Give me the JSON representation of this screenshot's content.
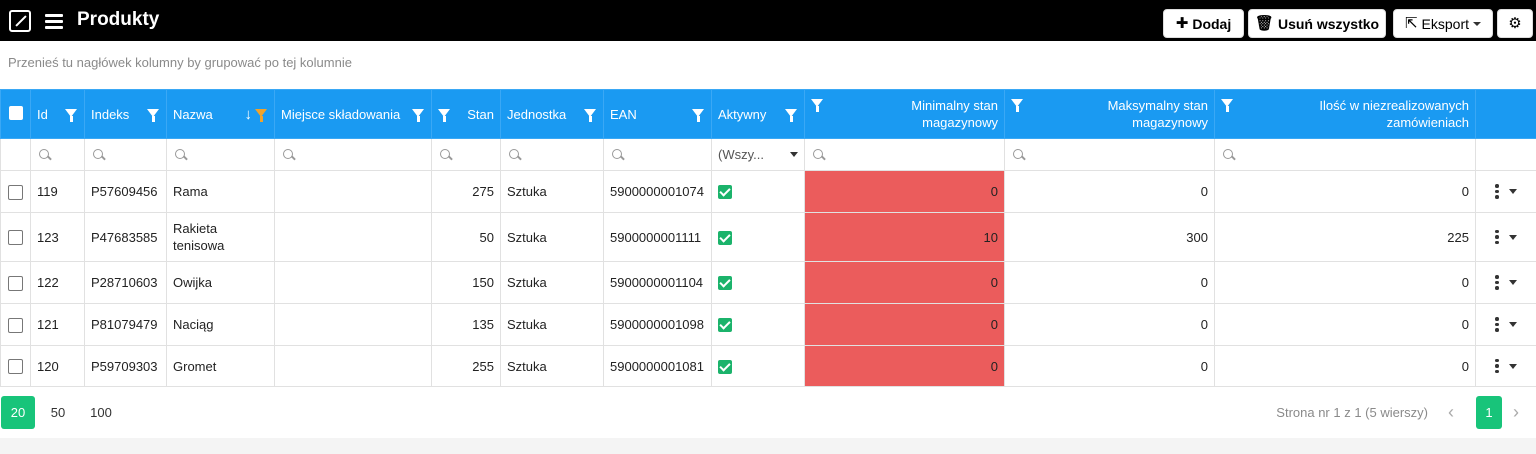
{
  "header": {
    "title": "Produkty",
    "buttons": {
      "add": "Dodaj",
      "delete_all": "Usuń wszystko",
      "export": "Eksport"
    }
  },
  "group_hint": "Przenieś tu nagłówek kolumny by grupować po tej kolumnie",
  "columns": {
    "id": "Id",
    "index": "Indeks",
    "name": "Nazwa",
    "location": "Miejsce składowania",
    "stock": "Stan",
    "unit": "Jednostka",
    "ean": "EAN",
    "active": "Aktywny",
    "min_stock_1": "Minimalny stan",
    "min_stock_2": "magazynowy",
    "max_stock_1": "Maksymalny stan",
    "max_stock_2": "magazynowy",
    "pending_1": "Ilość w niezrealizowanych",
    "pending_2": "zamówieniach"
  },
  "filters": {
    "active_value": "(Wszy..."
  },
  "rows": [
    {
      "id": "119",
      "index": "P57609456",
      "name": "Rama",
      "location": "",
      "stock": "275",
      "unit": "Sztuka",
      "ean": "5900000001074",
      "min": "0",
      "max": "0",
      "pending": "0"
    },
    {
      "id": "123",
      "index": "P47683585",
      "name": "Rakieta tenisowa",
      "location": "",
      "stock": "50",
      "unit": "Sztuka",
      "ean": "5900000001111",
      "min": "10",
      "max": "300",
      "pending": "225"
    },
    {
      "id": "122",
      "index": "P28710603",
      "name": "Owijka",
      "location": "",
      "stock": "150",
      "unit": "Sztuka",
      "ean": "5900000001104",
      "min": "0",
      "max": "0",
      "pending": "0"
    },
    {
      "id": "121",
      "index": "P81079479",
      "name": "Naciąg",
      "location": "",
      "stock": "135",
      "unit": "Sztuka",
      "ean": "5900000001098",
      "min": "0",
      "max": "0",
      "pending": "0"
    },
    {
      "id": "120",
      "index": "P59709303",
      "name": "Gromet",
      "location": "",
      "stock": "255",
      "unit": "Sztuka",
      "ean": "5900000001081",
      "min": "0",
      "max": "0",
      "pending": "0"
    }
  ],
  "pager": {
    "sizes": [
      "20",
      "50",
      "100"
    ],
    "info": "Strona nr 1 z 1 (5 wierszy)",
    "current_page": "1",
    "prev": "‹",
    "next": "›"
  },
  "colors": {
    "topbar": "#000000",
    "header": "#1a9af2",
    "low_stock": "#eb5c5c",
    "accent_green": "#18c47a",
    "filter_sorted": "#f0a32b"
  }
}
